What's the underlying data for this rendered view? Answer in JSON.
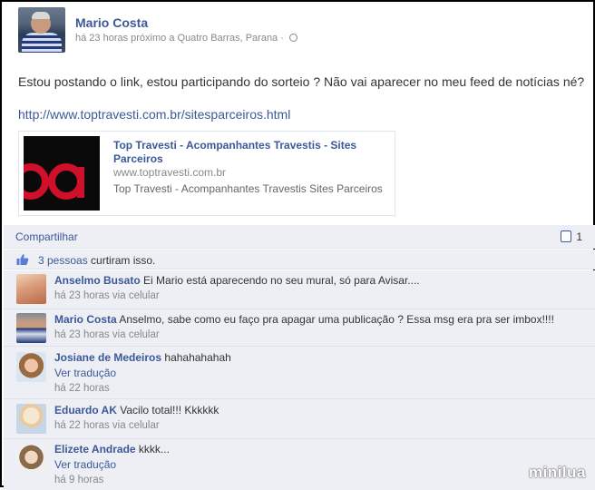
{
  "post": {
    "author": "Mario Costa",
    "meta": "há 23 horas próximo a Quatro Barras, Parana ·",
    "text": "Estou postando o link, estou participando do sorteio ? Não vai aparecer no meu feed de notícias né?",
    "link": "http://www.toptravesti.com.br/sitesparceiros.html",
    "share": {
      "title": "Top Travesti - Acompanhantes Travestis - Sites Parceiros",
      "domain": "www.toptravesti.com.br",
      "description": "Top Travesti - Acompanhantes Travestis Sites Parceiros",
      "thumb_text": "oa"
    }
  },
  "actions": {
    "share_label": "Compartilhar",
    "comment_count": "1"
  },
  "likes": {
    "count_link": "3 pessoas",
    "suffix": " curtiram isso."
  },
  "comments": [
    {
      "author": "Anselmo Busato",
      "text": "Ei Mario está aparecendo no seu mural, só para Avisar....",
      "translate": "",
      "meta": "há 23 horas via celular"
    },
    {
      "author": "Mario Costa",
      "text": "Anselmo, sabe como eu faço pra apagar uma publicação ? Essa msg era pra ser imbox!!!!",
      "translate": "",
      "meta": "há 23 horas via celular"
    },
    {
      "author": "Josiane de Medeiros",
      "text": "hahahahahah",
      "translate": "Ver tradução",
      "meta": "há 22 horas"
    },
    {
      "author": "Eduardo AK",
      "text": "Vacilo total!!! Kkkkkk",
      "translate": "",
      "meta": "há 22 horas via celular"
    },
    {
      "author": "Elizete Andrade",
      "text": "kkkk...",
      "translate": "Ver tradução",
      "meta": "há 9 horas"
    }
  ],
  "watermark": "minilua",
  "colors": {
    "link_blue": "#3b5998",
    "panel_bg": "#edeff4"
  }
}
